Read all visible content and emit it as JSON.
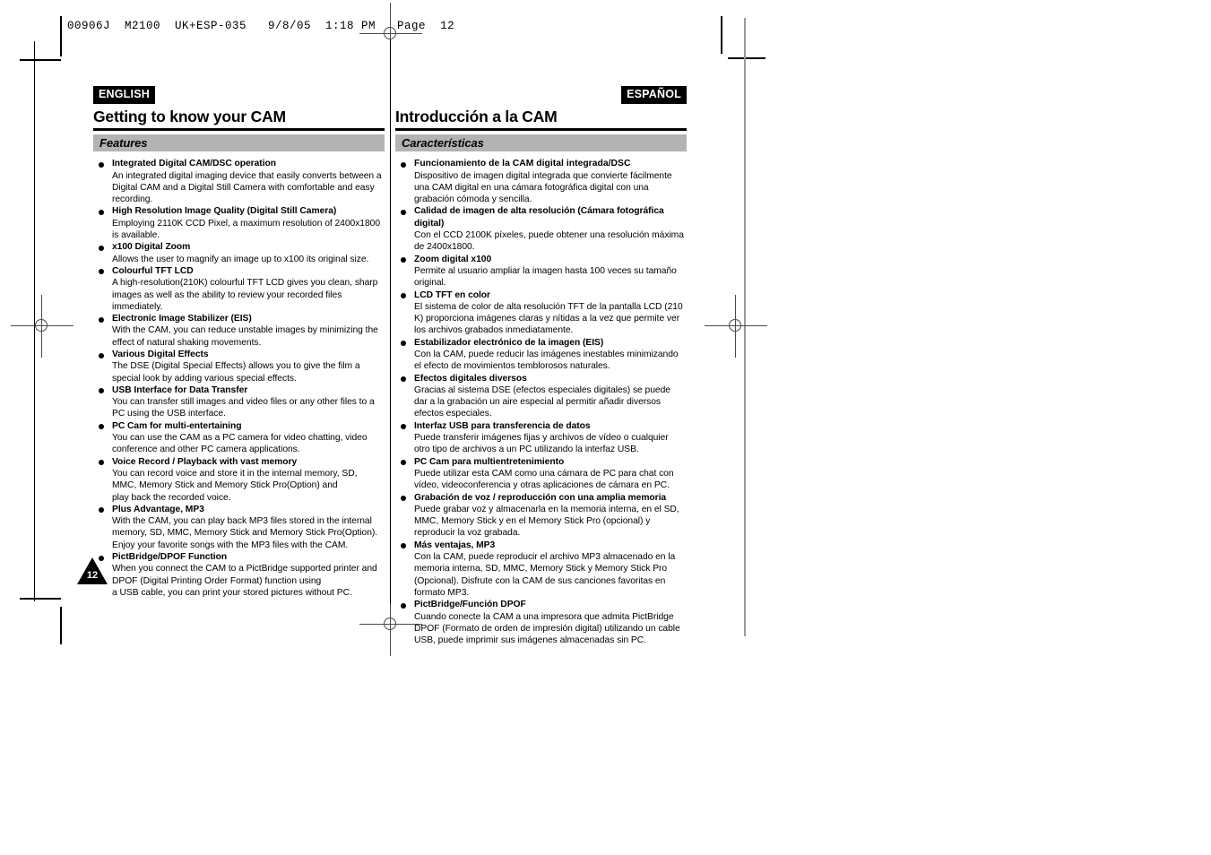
{
  "slug": "00906J  M2100  UK+ESP-035   9/8/05  1:18 PM   Page  12",
  "page_number": "12",
  "columns": {
    "english": {
      "lang_tag": "ENGLISH",
      "chapter_title": "Getting to know your CAM",
      "section_title": "Features",
      "features": [
        {
          "heading": "Integrated Digital CAM/DSC operation",
          "body": "An integrated digital imaging device that easily converts between a\nDigital CAM and a Digital Still Camera with comfortable and easy\nrecording."
        },
        {
          "heading": "High Resolution Image Quality (Digital Still Camera)",
          "body": "Employing 2110K CCD Pixel, a maximum resolution of 2400x1800\nis available."
        },
        {
          "heading": "x100 Digital Zoom",
          "body": "Allows the user to magnify an image up to x100 its original size."
        },
        {
          "heading": "Colourful TFT LCD",
          "body": "A high-resolution(210K) colourful TFT LCD gives you clean, sharp\nimages as well as the ability to review your recorded files\nimmediately."
        },
        {
          "heading": "Electronic Image Stabilizer (EIS)",
          "body": "With the CAM, you can reduce unstable images by minimizing the\neffect of natural shaking movements."
        },
        {
          "heading": "Various Digital Effects",
          "body": "The DSE (Digital Special Effects) allows you to give the film a\nspecial look by adding various special effects."
        },
        {
          "heading": "USB Interface for Data Transfer",
          "body": "You can transfer still images and video files or any other files to a\nPC using the USB interface."
        },
        {
          "heading": "PC Cam for multi-entertaining",
          "body": "You can use the CAM as a PC camera for video chatting, video\nconference and other PC camera applications."
        },
        {
          "heading": "Voice Record / Playback with vast memory",
          "body": "You can record voice and store it in the internal memory, SD,\nMMC, Memory Stick and Memory Stick Pro(Option) and\nplay back the recorded voice."
        },
        {
          "heading": "Plus Advantage, MP3",
          "body": "With the CAM, you can play back MP3 files stored in the internal\nmemory, SD, MMC, Memory Stick and Memory Stick Pro(Option).\nEnjoy your favorite songs with the MP3 files with the CAM."
        },
        {
          "heading": "PictBridge/DPOF Function",
          "body": "When you connect the CAM to a PictBridge supported printer and\nDPOF (Digital Printing Order Format) function using\na USB cable, you can print your stored pictures without PC."
        }
      ]
    },
    "spanish": {
      "lang_tag": "ESPAÑOL",
      "chapter_title": "Introducción a la CAM",
      "section_title": "Características",
      "features": [
        {
          "heading": "Funcionamiento de la CAM digital integrada/DSC",
          "body": "Dispositivo de imagen digital integrada que convierte fácilmente\nuna CAM digital en una cámara fotográfica digital con una\ngrabación cómoda y sencilla."
        },
        {
          "heading": "Calidad de imagen de alta resolución (Cámara fotográfica digital)",
          "body": "Con el CCD 2100K píxeles, puede obtener una resolución máxima\nde 2400x1800."
        },
        {
          "heading": "Zoom digital x100",
          "body": "Permite al usuario ampliar la imagen hasta 100 veces su tamaño\noriginal."
        },
        {
          "heading": "LCD TFT en color",
          "body": "El sistema de color de alta resolución TFT de la pantalla LCD (210\nK) proporciona imágenes claras y nítidas a la vez que permite ver\nlos archivos grabados inmediatamente."
        },
        {
          "heading": "Estabilizador electrónico de la imagen (EIS)",
          "body": "Con la CAM, puede reducir las imágenes inestables minimizando\nel efecto de movimientos temblorosos naturales."
        },
        {
          "heading": "Efectos digitales diversos",
          "body": "Gracias al sistema DSE (efectos especiales digitales) se puede\ndar a la grabación un aire especial al permitir añadir diversos\nefectos especiales."
        },
        {
          "heading": "Interfaz USB para transferencia de datos",
          "body": "Puede transferir imágenes fijas y archivos de vídeo o cualquier\notro tipo de archivos a un PC utilizando la interfaz USB."
        },
        {
          "heading": "PC Cam para multientretenimiento",
          "body": "Puede utilizar esta CAM como una cámara de PC para chat con\nvídeo, videoconferencia y otras aplicaciones de cámara en PC."
        },
        {
          "heading": "Grabación de voz / reproducción con una amplia memoria",
          "body": "Puede grabar voz y almacenarla en la memoria interna, en el SD,\nMMC, Memory Stick y en el Memory Stick Pro (opcional) y\nreproducir la voz grabada."
        },
        {
          "heading": "Más ventajas, MP3",
          "body": "Con la CAM, puede reproducir el archivo MP3 almacenado en la\nmemoria interna, SD, MMC, Memory Stick y Memory Stick Pro\n(Opcional). Disfrute con la CAM de sus canciones favoritas en\nformato MP3."
        },
        {
          "heading": "PictBridge/Función DPOF",
          "body": "Cuando conecte la CAM a una impresora que admita PictBridge\nDPOF (Formato de orden de impresión digital) utilizando un cable\nUSB, puede imprimir sus imágenes almacenadas sin PC."
        }
      ]
    }
  }
}
